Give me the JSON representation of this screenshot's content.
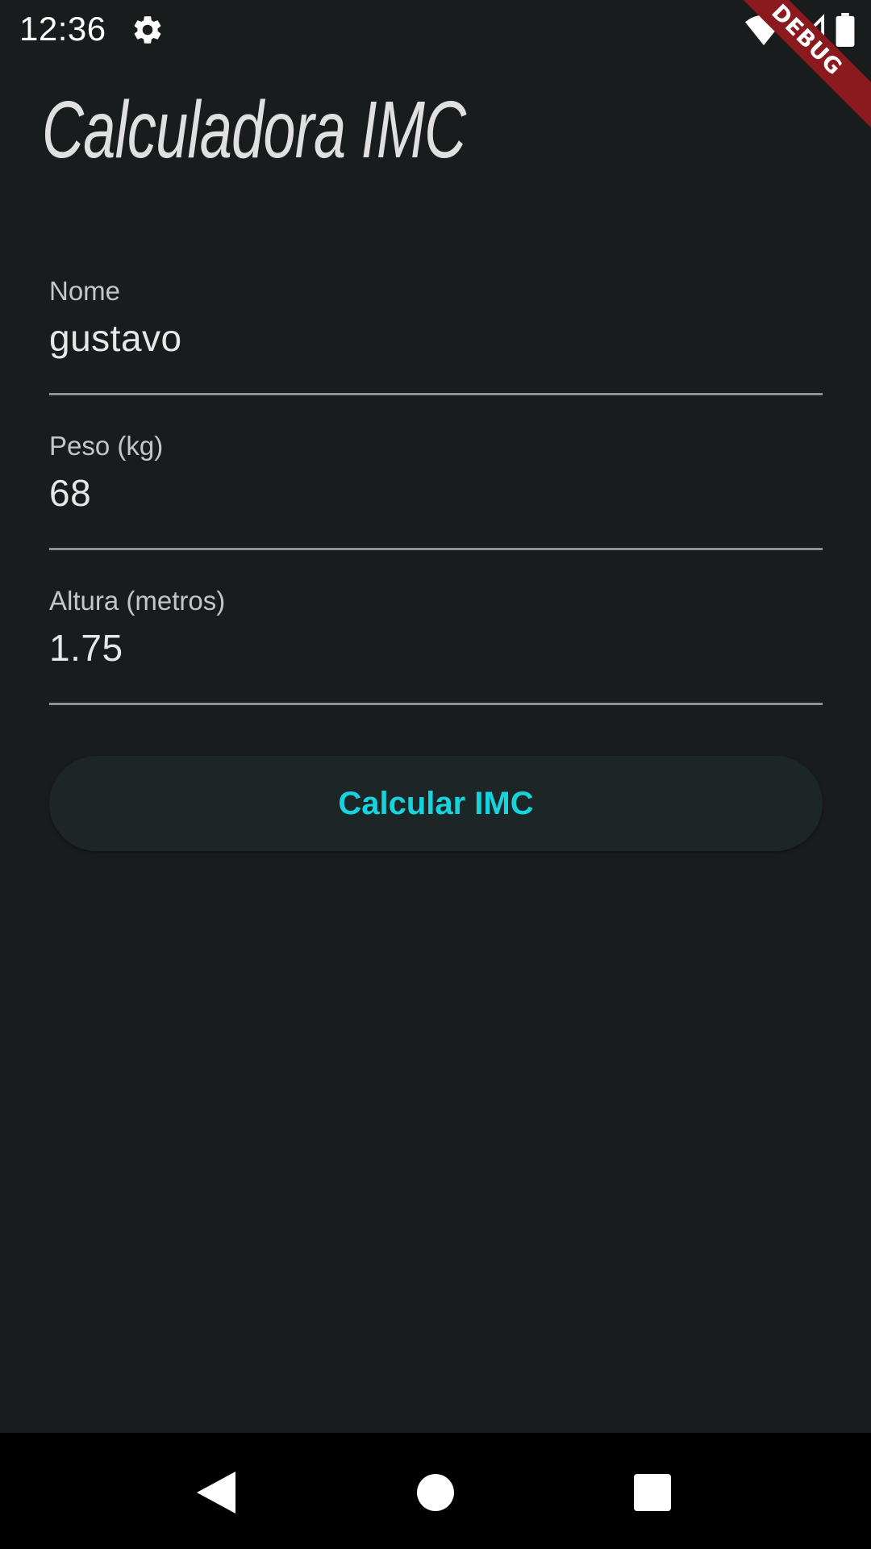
{
  "status_bar": {
    "time": "12:36",
    "debug_label": "DEBUG"
  },
  "app": {
    "title": "Calculadora IMC"
  },
  "form": {
    "fields": [
      {
        "label": "Nome",
        "value": "gustavo"
      },
      {
        "label": "Peso (kg)",
        "value": "68"
      },
      {
        "label": "Altura (metros)",
        "value": "1.75"
      }
    ],
    "submit_label": "Calcular IMC"
  },
  "colors": {
    "background": "#191c1d",
    "accent": "#17d3dd",
    "debug_banner": "#8b1a1e"
  },
  "icons": {
    "status": [
      "gear-icon",
      "wifi-icon",
      "cell-signal-icon",
      "battery-icon"
    ],
    "nav": [
      "back-icon",
      "home-icon",
      "recents-icon"
    ]
  }
}
